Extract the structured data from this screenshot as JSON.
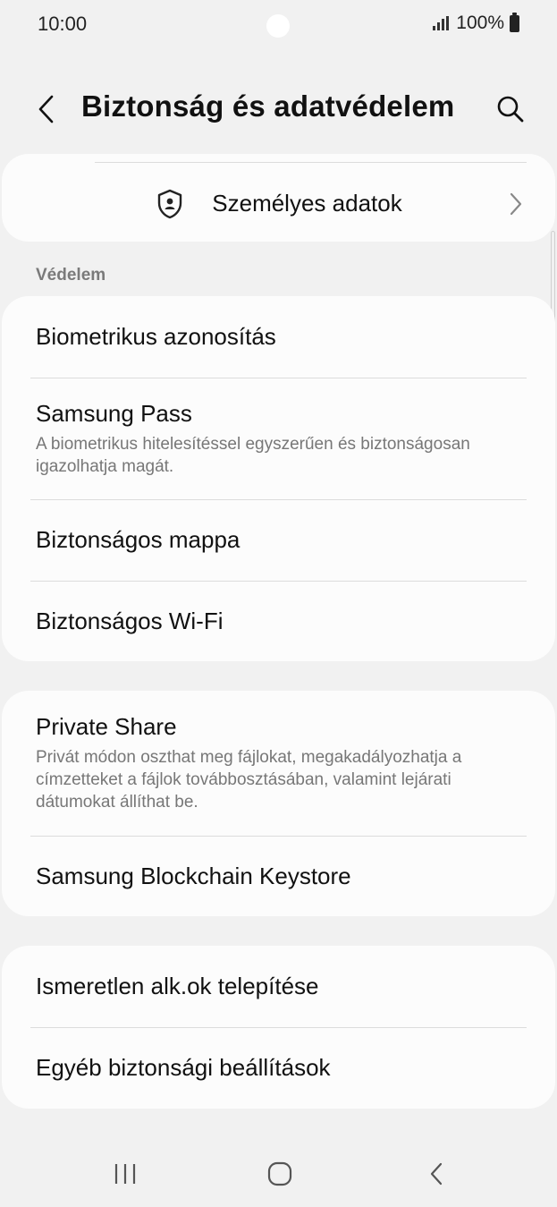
{
  "status_bar": {
    "time": "10:00",
    "battery": "100%"
  },
  "header": {
    "title": "Biztonság és adatvédelem"
  },
  "personal": {
    "label": "Személyes adatok"
  },
  "section_protection": "Védelem",
  "protection_items": [
    {
      "title": "Biometrikus azonosítás"
    },
    {
      "title": "Samsung Pass",
      "subtitle": "A biometrikus hitelesítéssel egyszerűen és biztonságosan igazolhatja magát."
    },
    {
      "title": "Biztonságos mappa"
    },
    {
      "title": "Biztonságos Wi-Fi"
    }
  ],
  "share_items": [
    {
      "title": "Private Share",
      "subtitle": "Privát módon oszthat meg fájlokat, megakadályozhatja a címzetteket a fájlok továbbosztásában, valamint lejárati dátumokat állíthat be."
    },
    {
      "title": "Samsung Blockchain Keystore"
    }
  ],
  "other_items": [
    {
      "title": "Ismeretlen alk.ok telepítése"
    },
    {
      "title": "Egyéb biztonsági beállítások"
    }
  ],
  "icons": {
    "back": "back-arrow-icon",
    "search": "search-icon",
    "personal": "shield-person-icon",
    "chevron": "chevron-right-icon",
    "nav_recents": "recents-icon",
    "nav_home": "home-icon",
    "nav_back": "nav-back-icon"
  }
}
